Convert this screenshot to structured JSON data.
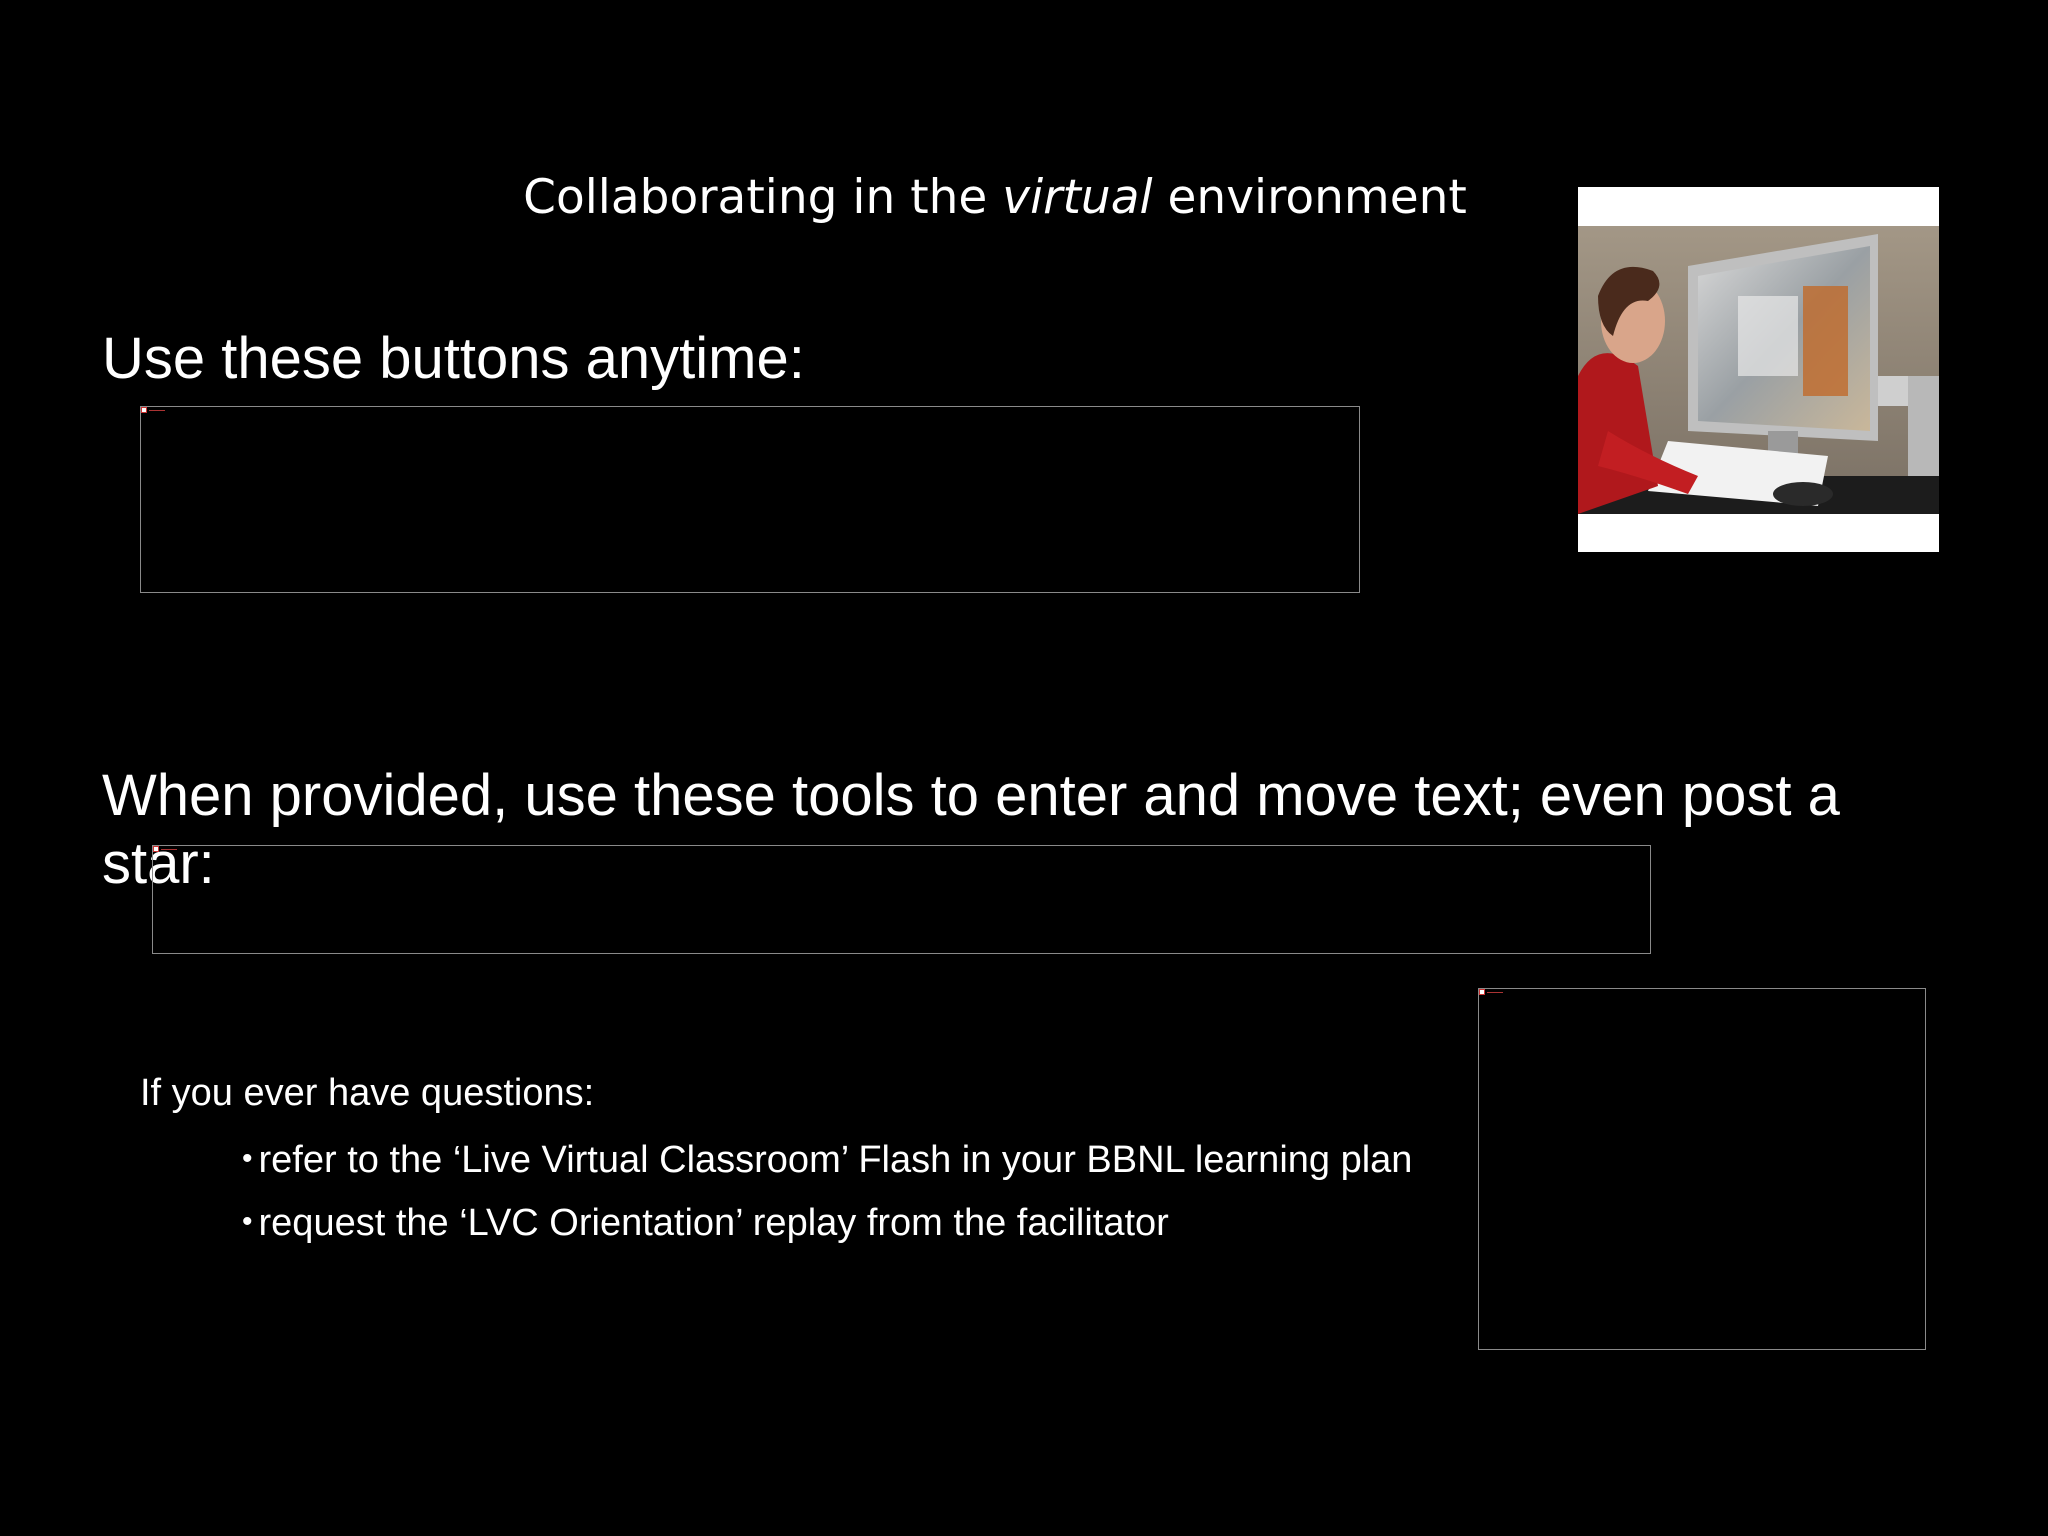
{
  "slide": {
    "title": {
      "before": "Collaborating in the ",
      "emphasis": "virtual",
      "after": " environment"
    },
    "heading_buttons": "Use these buttons anytime:",
    "heading_tools": "When provided, use these tools to enter and move text; even post a star:",
    "questions": {
      "lead": "If you ever have questions:",
      "items": [
        "refer to the ‘Live Virtual Classroom’ Flash in your BBNL learning plan",
        "request the ‘LVC Orientation’ replay from the facilitator"
      ],
      "bullet": "•"
    }
  },
  "colors": {
    "background": "#000000",
    "text": "#ffffff",
    "placeholder_border": "#8a8a8a"
  },
  "photo": {
    "icon": "person-at-computer-photo"
  }
}
